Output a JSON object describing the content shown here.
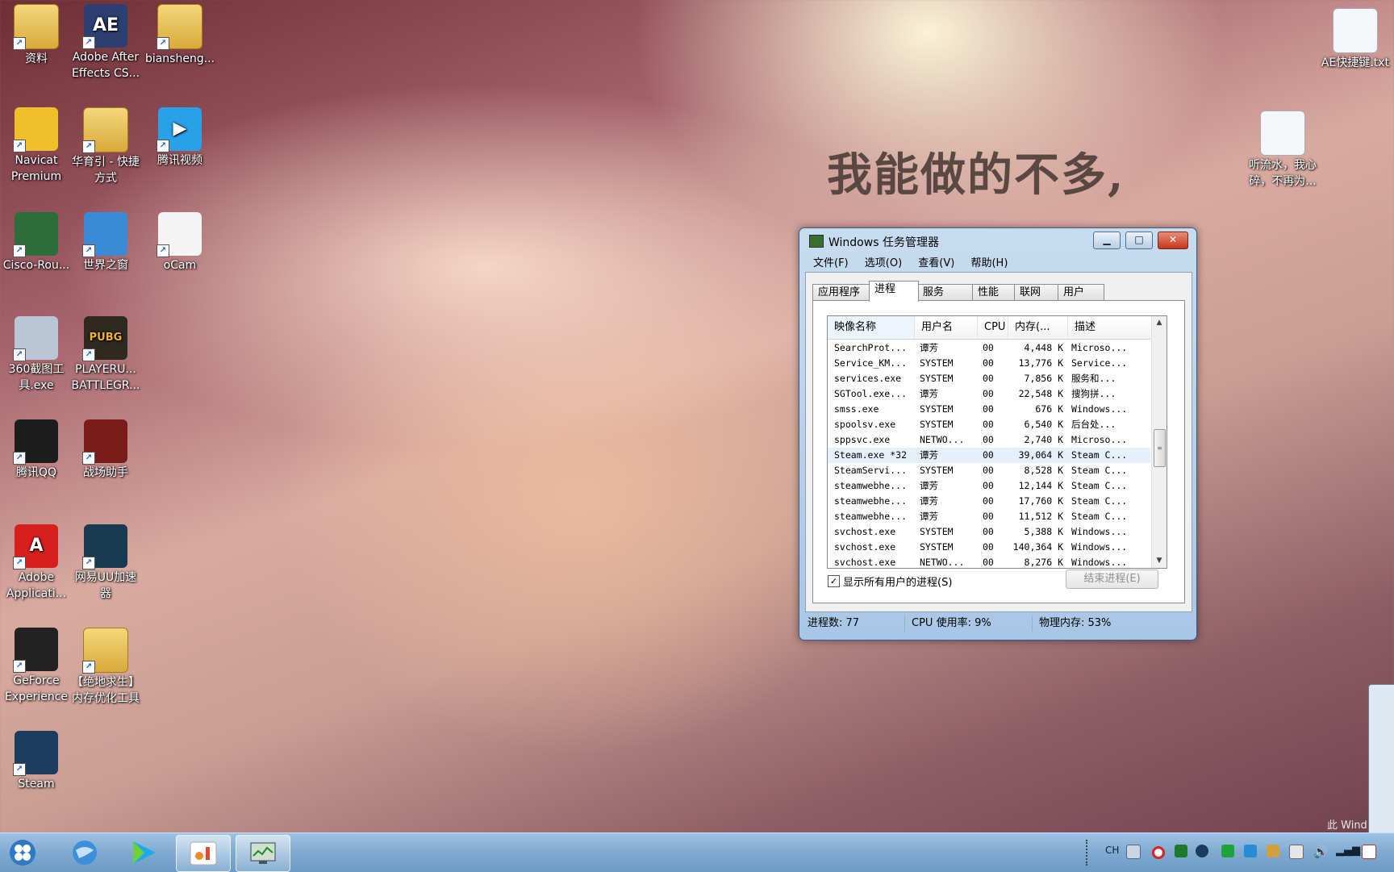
{
  "desktop": {
    "icons": [
      {
        "label": "资料",
        "color": "#e2b34c",
        "glyph": ""
      },
      {
        "label": "Adobe After Effects CS...",
        "color": "#2c3f73",
        "glyph": "AE"
      },
      {
        "label": "biansheng...",
        "color": "#e2b34c",
        "glyph": ""
      },
      {
        "label": "Navicat Premium",
        "color": "#f0c02a",
        "glyph": ""
      },
      {
        "label": "华育引 - 快捷方式",
        "color": "#e2b34c",
        "glyph": ""
      },
      {
        "label": "腾讯视频",
        "color": "#2aa0e8",
        "glyph": "▶"
      },
      {
        "label": "Cisco-Rou...",
        "color": "#2b6e3a",
        "glyph": ""
      },
      {
        "label": "世界之窗",
        "color": "#3a8ad6",
        "glyph": ""
      },
      {
        "label": "oCam",
        "color": "#f4f4f4",
        "glyph": ""
      },
      {
        "label": "360截图工具.exe",
        "color": "#b8c6d6",
        "glyph": ""
      },
      {
        "label": "PLAYERU... BATTLEGR...",
        "color": "#2e2a22",
        "glyph": "PUBG"
      },
      {
        "label": "腾讯QQ",
        "color": "#1d1d1d",
        "glyph": ""
      },
      {
        "label": "战场助手",
        "color": "#7a1c1c",
        "glyph": ""
      },
      {
        "label": "Adobe Applicati...",
        "color": "#d61f1f",
        "glyph": "A"
      },
      {
        "label": "网易UU加速器",
        "color": "#1a3a52",
        "glyph": ""
      },
      {
        "label": "GeForce Experience",
        "color": "#222222",
        "glyph": ""
      },
      {
        "label": "【绝地求生】内存优化工具",
        "color": "#e2b34c",
        "glyph": ""
      },
      {
        "label": "Steam",
        "color": "#1b3c5c",
        "glyph": ""
      },
      {
        "label": "AE快捷键.txt",
        "color": "#f4f6f8",
        "glyph": ""
      },
      {
        "label": "听流水，我心碎，不再为...",
        "color": "#f4f6f8",
        "glyph": ""
      }
    ],
    "quote_line1": "我能做的不多,",
    "quote_line2": "",
    "watermark": "此 Wind"
  },
  "window": {
    "title": "Windows 任务管理器",
    "menu": [
      "文件(F)",
      "选项(O)",
      "查看(V)",
      "帮助(H)"
    ],
    "tabs": [
      "应用程序",
      "进程",
      "服务",
      "性能",
      "联网",
      "用户"
    ],
    "active_tab": "进程",
    "columns": [
      "映像名称",
      "用户名",
      "CPU",
      "内存(...",
      "描述"
    ],
    "rows": [
      [
        "SearchProt...",
        "谭芳",
        "00",
        "4,448 K",
        "Microso..."
      ],
      [
        "Service_KM...",
        "SYSTEM",
        "00",
        "13,776 K",
        "Service..."
      ],
      [
        "services.exe",
        "SYSTEM",
        "00",
        "7,856 K",
        "服务和..."
      ],
      [
        "SGTool.exe...",
        "谭芳",
        "00",
        "22,548 K",
        "搜狗拼..."
      ],
      [
        "smss.exe",
        "SYSTEM",
        "00",
        "676 K",
        "Windows..."
      ],
      [
        "spoolsv.exe",
        "SYSTEM",
        "00",
        "6,540 K",
        "后台处..."
      ],
      [
        "sppsvc.exe",
        "NETWO...",
        "00",
        "2,740 K",
        "Microso..."
      ],
      [
        "Steam.exe *32",
        "谭芳",
        "00",
        "39,064 K",
        "Steam C..."
      ],
      [
        "SteamServi...",
        "SYSTEM",
        "00",
        "8,528 K",
        "Steam C..."
      ],
      [
        "steamwebhe...",
        "谭芳",
        "00",
        "12,144 K",
        "Steam C..."
      ],
      [
        "steamwebhe...",
        "谭芳",
        "00",
        "17,760 K",
        "Steam C..."
      ],
      [
        "steamwebhe...",
        "谭芳",
        "00",
        "11,512 K",
        "Steam C..."
      ],
      [
        "svchost.exe",
        "SYSTEM",
        "00",
        "5,388 K",
        "Windows..."
      ],
      [
        "svchost.exe",
        "SYSTEM",
        "00",
        "140,364 K",
        "Windows..."
      ],
      [
        "svchost.exe",
        "NETWO...",
        "00",
        "8,276 K",
        "Windows..."
      ]
    ],
    "show_all_users_label": "显示所有用户的进程(S)",
    "show_all_users_checked": true,
    "end_process_label": "结束进程(E)",
    "status": {
      "processes": "进程数: 77",
      "cpu": "CPU 使用率: 9%",
      "memory": "物理内存: 53%"
    }
  },
  "taskbar": {
    "tray_lang": "CH",
    "accent": "#7eaad2"
  }
}
